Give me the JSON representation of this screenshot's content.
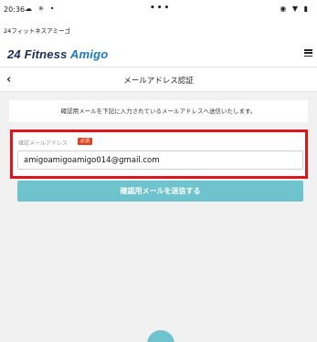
{
  "status_bar": {
    "time": "20:36",
    "left_icons": "☁ ✳ •",
    "center_dots": "•••",
    "right_icons": "◉ ▼ ▮"
  },
  "app": {
    "name": "24フィットネスアミーゴ"
  },
  "header": {
    "logo_part1": "24 Fitness ",
    "logo_part2": "Amigo",
    "menu_icon": "hamburger-menu"
  },
  "title_bar": {
    "back_icon": "‹",
    "title": "メールアドレス認証"
  },
  "notice": {
    "text": "確認用メールを下記に入力されているメールアドレスへ送信いたします。"
  },
  "form": {
    "label": "確認メールアドレス",
    "required_badge": "必須",
    "email_value": "amigoamigoamigo014@gmail.com",
    "highlight_color": "#e0151c"
  },
  "actions": {
    "send_label": "確認用メールを送信する",
    "send_color": "#6ec3cc"
  }
}
